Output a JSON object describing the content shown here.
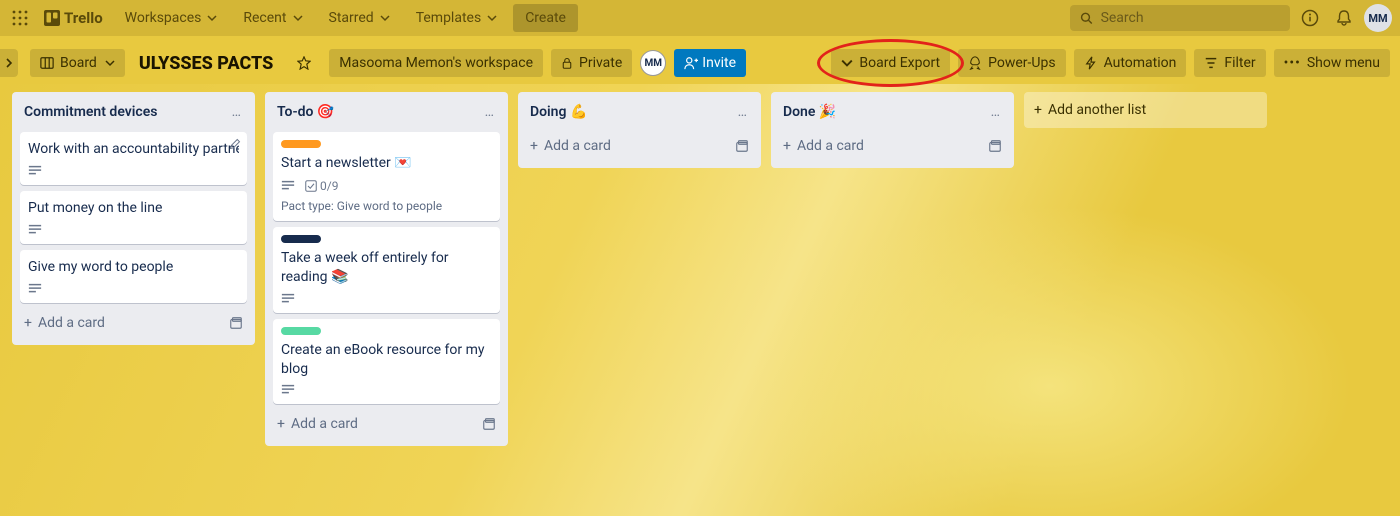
{
  "topbar": {
    "logo_text": "Trello",
    "nav": [
      "Workspaces",
      "Recent",
      "Starred",
      "Templates"
    ],
    "create": "Create",
    "search_placeholder": "Search",
    "avatar_initials": "MM"
  },
  "board_header": {
    "view_label": "Board",
    "title": "ULYSSES PACTS",
    "workspace": "Masooma Memon's workspace",
    "visibility": "Private",
    "member_initials": "MM",
    "invite": "Invite",
    "board_export": "Board Export",
    "power_ups": "Power-Ups",
    "automation": "Automation",
    "filter": "Filter",
    "show_menu": "Show menu"
  },
  "lists": [
    {
      "title": "Commitment devices",
      "cards": [
        {
          "title": "Work with an accountability partner",
          "has_desc": true,
          "has_edit": true
        },
        {
          "title": "Put money on the line",
          "has_desc": true
        },
        {
          "title": "Give my word to people",
          "has_desc": true
        }
      ]
    },
    {
      "title": "To-do 🎯",
      "cards": [
        {
          "label_color": "#ff991f",
          "title": "Start a newsletter 💌",
          "has_desc": true,
          "checklist": "0/9",
          "meta": "Pact type: Give word to people"
        },
        {
          "label_color": "#172b4d",
          "title": "Take a week off entirely for reading 📚",
          "has_desc": true
        },
        {
          "label_color": "#57d9a3",
          "title": "Create an eBook resource for my blog",
          "has_desc": true
        }
      ]
    },
    {
      "title": "Doing 💪",
      "cards": []
    },
    {
      "title": "Done 🎉",
      "cards": []
    }
  ],
  "add_card": "Add a card",
  "add_list": "Add another list"
}
